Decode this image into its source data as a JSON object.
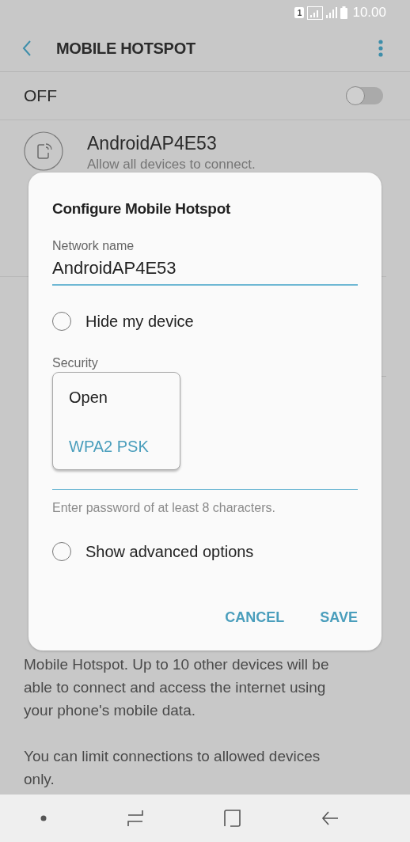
{
  "status_bar": {
    "sim": "1",
    "time": "10.00"
  },
  "toolbar": {
    "title": "MOBILE HOTSPOT"
  },
  "master_switch": {
    "label": "OFF",
    "on": false
  },
  "network": {
    "name": "AndroidAP4E53",
    "subtitle": "Allow all devices to connect."
  },
  "description": {
    "paragraphs": [
      "Mobile Hotspot. Up to 10 other devices will be able to connect and access the internet using your phone's mobile data.",
      "You can limit connections to allowed devices only."
    ]
  },
  "dialog": {
    "title": "Configure Mobile Hotspot",
    "network_name": {
      "label": "Network name",
      "value": "AndroidAP4E53"
    },
    "hide_device": {
      "label": "Hide my device",
      "checked": false
    },
    "security": {
      "label": "Security",
      "menu": [
        {
          "label": "Open",
          "selected": false
        },
        {
          "label": "WPA2 PSK",
          "selected": true
        }
      ]
    },
    "password": {
      "hint": "Enter password of at least 8 characters."
    },
    "advanced": {
      "label": "Show advanced options",
      "checked": false
    },
    "buttons": [
      "CANCEL",
      "SAVE"
    ]
  }
}
